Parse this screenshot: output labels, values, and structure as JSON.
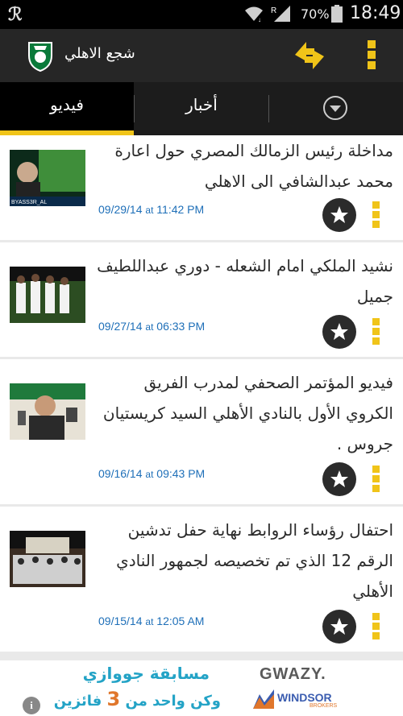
{
  "status_bar": {
    "battery_percent": "70%",
    "time": "18:49",
    "roaming_indicator": "R",
    "icons": [
      "app-notification-icon",
      "wifi-icon",
      "signal-icon",
      "battery-icon"
    ]
  },
  "app_bar": {
    "title": "شجع الاهلي",
    "icons": [
      "club-logo-icon",
      "refresh-icon",
      "overflow-menu-icon"
    ]
  },
  "tabs": [
    {
      "label": "فيديو",
      "active": true
    },
    {
      "label": "أخبار",
      "active": false
    }
  ],
  "tabs_dropdown_icon": "chevron-down-icon",
  "videos": [
    {
      "title": "مداخلة رئيس الزمالك المصري حول اعارة محمد عبدالشافي الى الاهلي",
      "date": "09/29/14",
      "at": "at",
      "time": "11:42 PM",
      "thumb_caption": "BYASS3R_AL"
    },
    {
      "title": "نشيد الملكي امام الشعله - دوري عبداللطيف جميل",
      "date": "09/27/14",
      "at": "at",
      "time": "06:33 PM"
    },
    {
      "title": "فيديو المؤتمر الصحفي لمدرب الفريق الكروي الأول بالنادي الأهلي السيد كريستيان جروس .",
      "date": "09/16/14",
      "at": "at",
      "time": "09:43 PM"
    },
    {
      "title": "احتفال رؤساء الروابط نهاية حفل تدشين الرقم 12 الذي تم تخصيصه لجمهور النادي الأهلي",
      "date": "09/15/14",
      "at": "at",
      "time": "12:05 AM"
    }
  ],
  "ad": {
    "line1": "مسابقة جووازي",
    "line2_a": "وكن واحد من",
    "line2_num": "3",
    "line2_b": "فائزين",
    "brand1": "GWAZY.",
    "brand2": "WINDSOR",
    "brand2_sub": "BROKERS",
    "info_label": "i"
  },
  "colors": {
    "accent": "#f0c419",
    "date_blue": "#1e6fb8",
    "app_bar_bg": "#262626",
    "tab_bg": "#1c1c1c"
  }
}
